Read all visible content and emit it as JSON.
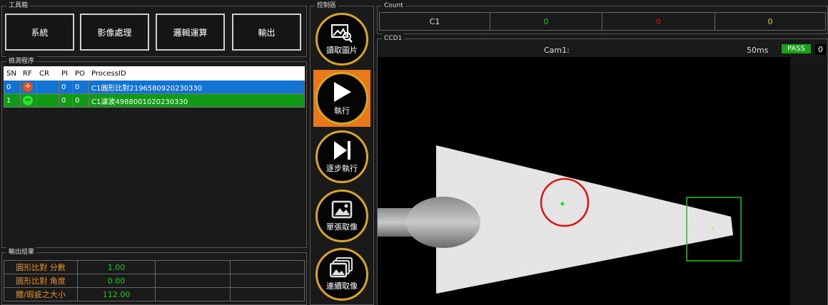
{
  "toolbox": {
    "title": "工具箱",
    "buttons": [
      "系統",
      "影像處理",
      "邏輯運算",
      "輸出"
    ]
  },
  "detection": {
    "title": "檢測程序",
    "headers": [
      "SN",
      "RF",
      "CR",
      "PI",
      "PO",
      "ProcessID"
    ],
    "rows": [
      {
        "sn": "0",
        "pi": "0",
        "po": "0",
        "process_id": "C1圓形比對2196580920230330",
        "rf_icon": "crosshair-icon",
        "color": "#1173d4"
      },
      {
        "sn": "1",
        "pi": "0",
        "po": "0",
        "process_id": "C1濾波4988001020230330",
        "rf_icon": "arrows-icon",
        "color": "#119a15"
      }
    ]
  },
  "results": {
    "title": "輸出結果",
    "rows": [
      {
        "label": "圓形比對 分數",
        "value": "1.00"
      },
      {
        "label": "圓形比對 角度",
        "value": "0.00"
      },
      {
        "label": "體/瑕疵之大小",
        "value": "112.00"
      }
    ]
  },
  "control": {
    "title": "控制區",
    "buttons": [
      {
        "label": "讀取圖片",
        "icon": "load-image-icon"
      },
      {
        "label": "執行",
        "icon": "play-icon"
      },
      {
        "label": "逐步執行",
        "icon": "step-icon"
      },
      {
        "label": "單張取像",
        "icon": "single-capture-icon"
      },
      {
        "label": "連續取像",
        "icon": "continuous-capture-icon"
      }
    ]
  },
  "count": {
    "title": "Count",
    "camera": "C1",
    "values": [
      "0",
      "0",
      "0"
    ],
    "colors": [
      "#1ec81e",
      "#d01818",
      "#e0d020"
    ]
  },
  "ccd": {
    "title": "CCD1",
    "camera_label": "Cam1:",
    "time": "50ms",
    "status": "PASS",
    "status_color": "#16a316",
    "counter": "0"
  }
}
